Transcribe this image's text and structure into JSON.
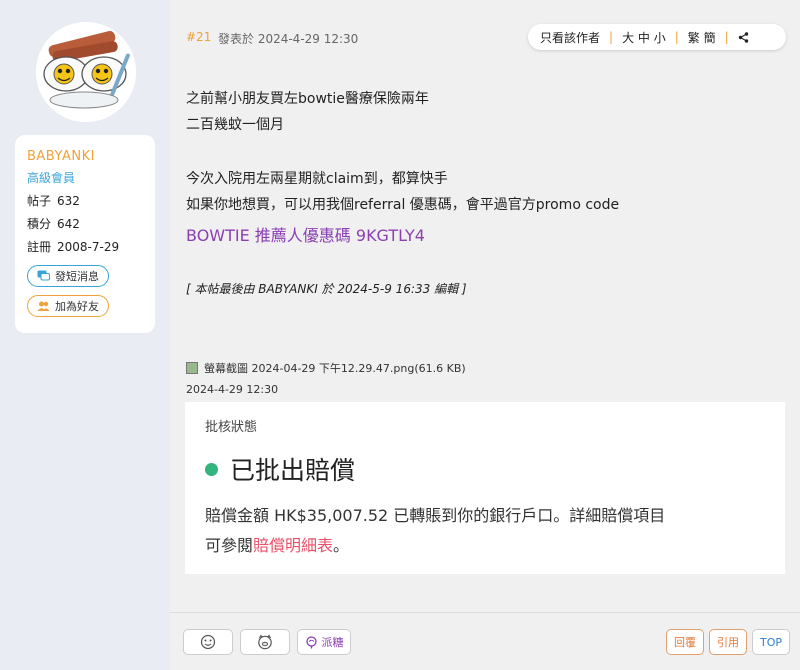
{
  "user": {
    "name": "BABYANKI",
    "rank": "高級會員",
    "stats": [
      {
        "label": "帖子",
        "value": "632"
      },
      {
        "label": "積分",
        "value": "642"
      },
      {
        "label": "註冊",
        "value": "2008-7-29"
      }
    ],
    "message_label": "發短消息",
    "add_friend_label": "加為好友"
  },
  "post": {
    "floor": "#21",
    "posted_at": "發表於 2024-4-29 12:30",
    "lines": [
      "之前幫小朋友買左bowtie醫療保險兩年",
      "二百幾蚊一個月",
      "今次入院用左兩星期就claim到，都算快手",
      "如果你地想買，可以用我個referral  優惠碼，會平過官方promo  code"
    ],
    "promo": "BOWTIE  推薦人優惠碼  9KGTLY4",
    "edited_note": "[   本帖最後由  BABYANKI  於  2024-5-9  16:33  編輯   ]"
  },
  "toolbar": {
    "author_only": "只看該作者",
    "font_size": "大 中 小",
    "script": "繁 簡",
    "separator": "|"
  },
  "attachment": {
    "filename": "螢幕截圖 2024-04-29 下午12.29.47.png(61.6 KB)",
    "time": "2024-4-29 12:30",
    "screenshot": {
      "label": "批核狀態",
      "status": "已批出賠償",
      "desc_prefix": "賠償金額 HK$35,007.52 已轉賬到你的銀行戶口。詳細賠償項目",
      "desc_line2_prefix": "可參閱",
      "link": "賠償明細表",
      "desc_suffix": "。",
      "status_color": "#35b37e"
    }
  },
  "footer": {
    "sugar_label": "派糖",
    "reply_label": "回覆",
    "quote_label": "引用",
    "top_label": "TOP"
  },
  "colors": {
    "accent": "#f0a13a",
    "rank": "#3aa3d9",
    "promo": "#8a3fb3",
    "link": "#e8506a"
  }
}
